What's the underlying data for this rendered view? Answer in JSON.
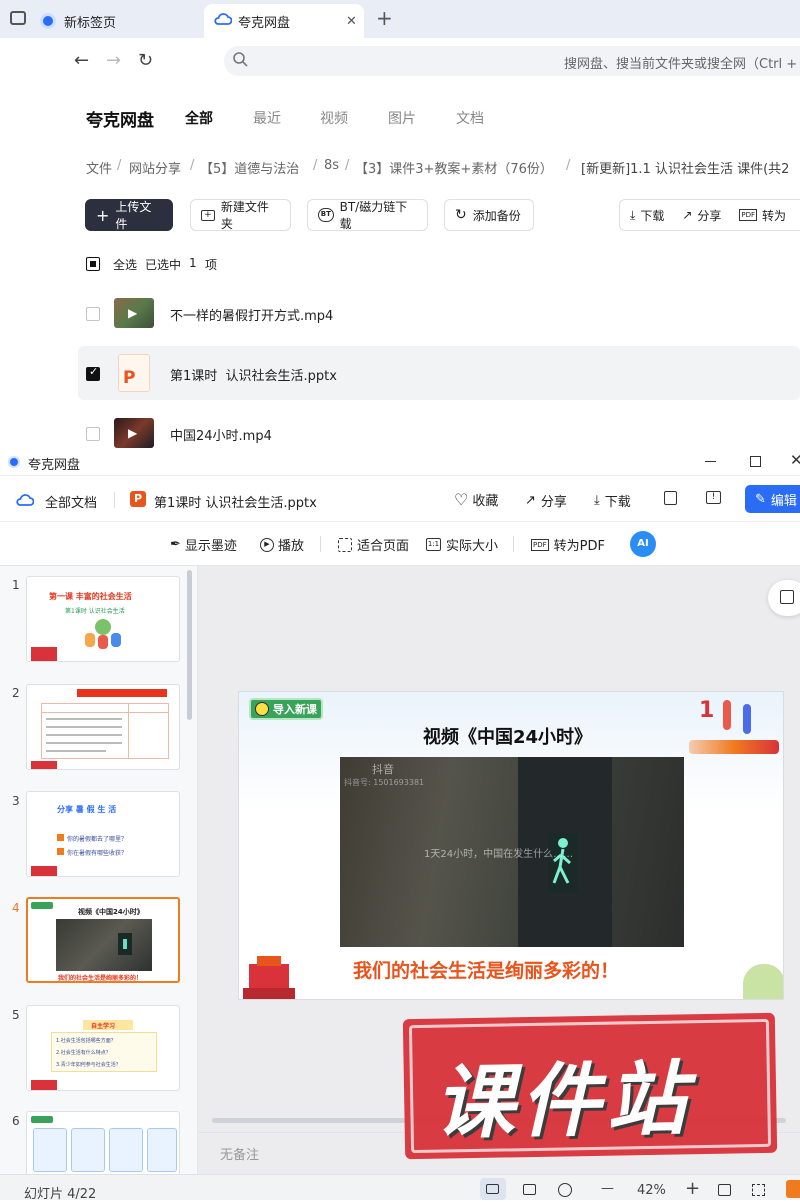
{
  "browser": {
    "tabs": [
      {
        "label": "新标签页",
        "active": false
      },
      {
        "label": "夸克网盘",
        "active": true
      }
    ],
    "new_tab": "+",
    "close_tab": "✕",
    "address_placeholder": "搜网盘、搜当前文件夹或搜全网（Ctrl + F"
  },
  "drive": {
    "logo": "夸克网盘",
    "nav": [
      "全部",
      "最近",
      "视频",
      "图片",
      "文档"
    ],
    "breadcrumb": [
      "文件",
      "网站分享",
      "【5】道德与法治",
      "8s",
      "【3】课件3+教案+素材（76份）",
      "[新更新]1.1 认识社会生活 课件(共2"
    ],
    "crumb_sep": "/",
    "toolbar": {
      "upload": "上传文件",
      "new_folder": "新建文件夹",
      "bt": "BT/磁力链下载",
      "backup": "添加备份",
      "download": "下载",
      "share": "分享",
      "to_pdf": "转为"
    },
    "select_all": "全选",
    "selected_text": "已选中",
    "selected_count": "1",
    "selected_unit": "项",
    "files": [
      {
        "name": "不一样的暑假打开方式.mp4",
        "checked": false
      },
      {
        "name": "第1课时  认识社会生活.pptx",
        "checked": true
      },
      {
        "name": "中国24小时.mp4",
        "checked": false
      }
    ]
  },
  "viewer": {
    "window_title": "夸克网盘",
    "all_docs": "全部文档",
    "file_title": "第1课时 认识社会生活.pptx",
    "actions": {
      "collect": "收藏",
      "share": "分享",
      "download": "下载",
      "edit": "编辑"
    },
    "tools": {
      "ink": "显示墨迹",
      "play": "播放",
      "fit": "适合页面",
      "actual": "实际大小",
      "pdf": "转为PDF",
      "ai": "AI"
    },
    "thumbnails": [
      {
        "num": "1",
        "title": "第一课  丰富的社会生活",
        "sub": "第1课时  认识社会生活"
      },
      {
        "num": "2",
        "title": "新课导入"
      },
      {
        "num": "3",
        "title": "分享  暑 假 生 活",
        "lines": [
          "你的暑假都去了哪里？",
          "你在暑假有哪些收获？"
        ]
      },
      {
        "num": "4",
        "title": "视频《中国24小时》",
        "caption": "我们的社会生活是绚丽多彩的！"
      },
      {
        "num": "5",
        "title": "自主学习",
        "lines": [
          "1.社会生活包括哪些方面？",
          "2.社会生活有什么特点？",
          "3.青少年如何参与社会生活？"
        ]
      },
      {
        "num": "6"
      }
    ],
    "slide": {
      "badge": "导入新课",
      "title": "视频《中国24小时》",
      "video_caption": "1天24小时，中国在发生什么……",
      "video_watermark": "抖音",
      "video_id": "抖音号: 1501693381",
      "bottom_text": "我们的社会生活是绚丽多彩的！"
    },
    "watermark": "课件站",
    "notes": "无备注",
    "status": {
      "slide_counter": "幻灯片 4/22",
      "zoom": "42%",
      "minus": "—",
      "plus": "+"
    }
  },
  "colors": {
    "accent_blue": "#2a6df4",
    "slide_red": "#e8341c",
    "slide_orange": "#f07b1f",
    "watermark_red": "#d9323a",
    "dark_button": "#2b2f3e"
  }
}
